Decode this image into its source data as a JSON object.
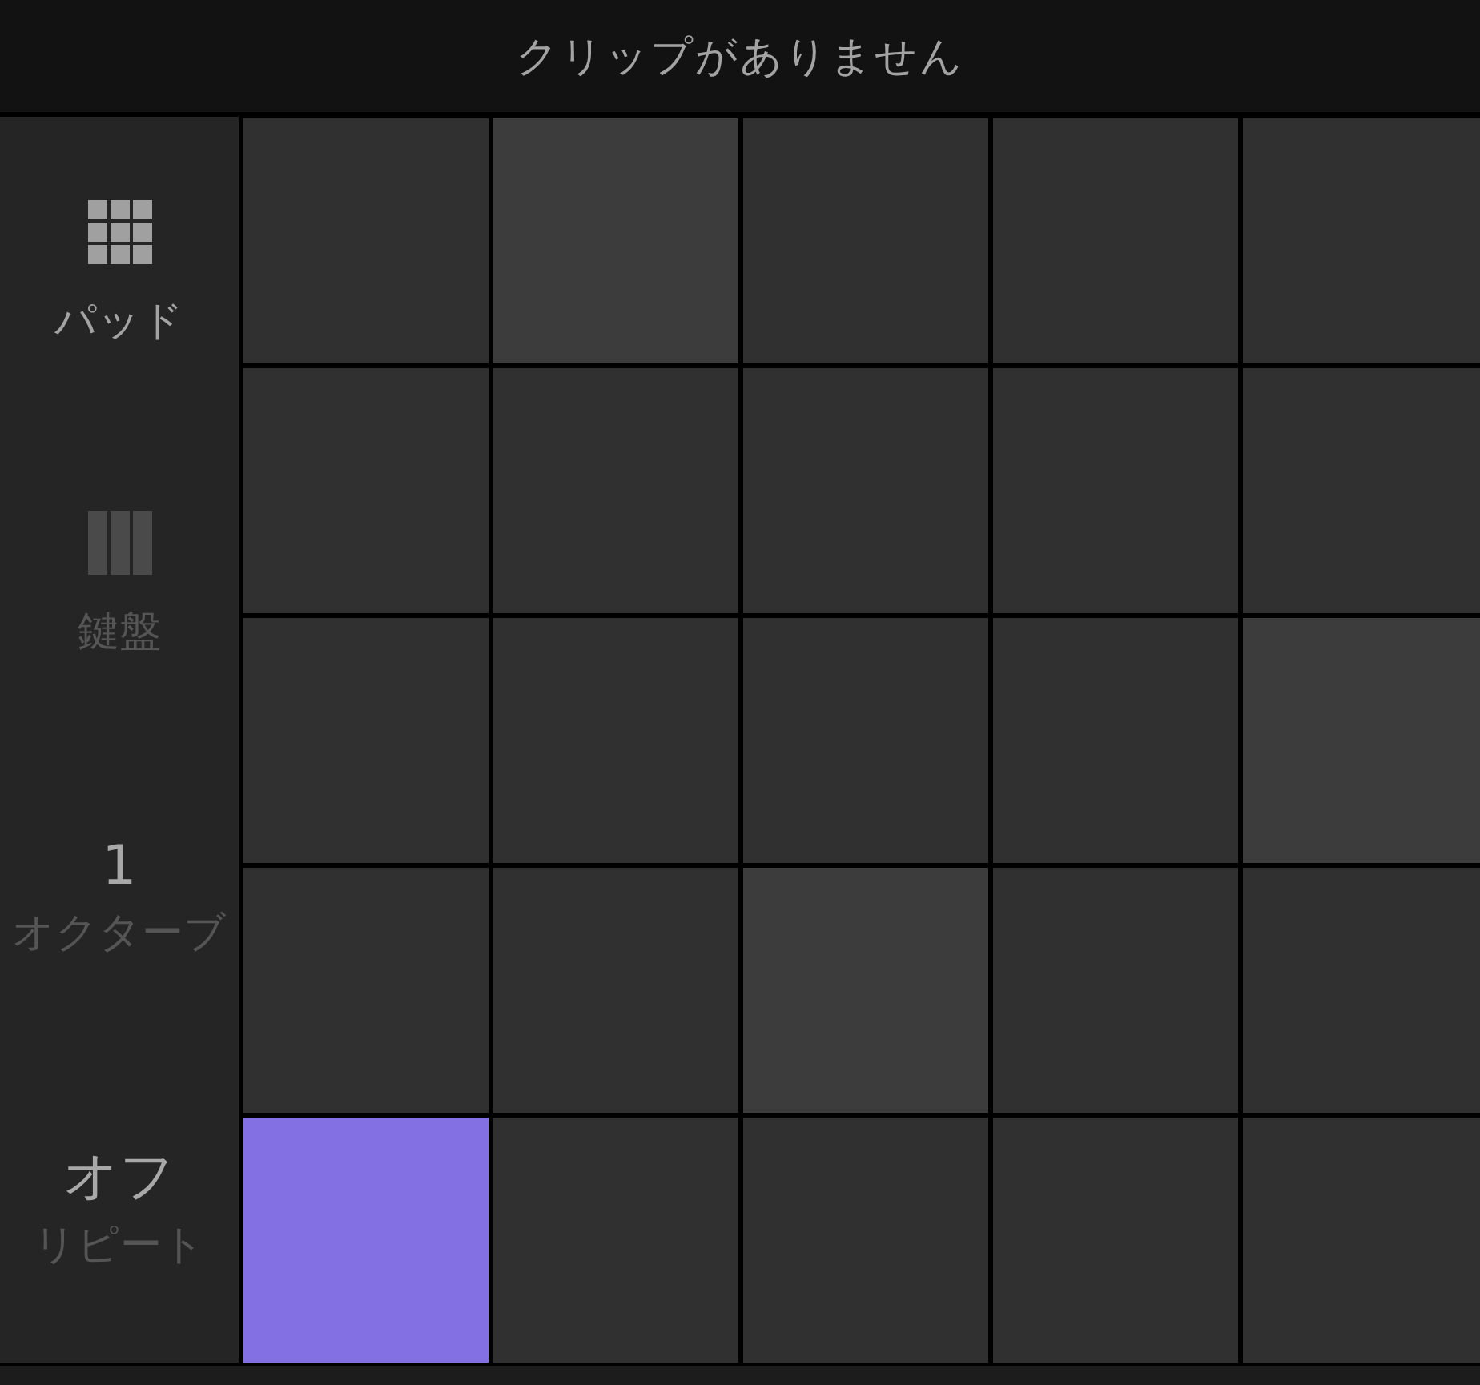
{
  "title": "クリップがありません",
  "sidebar": {
    "items": [
      {
        "kind": "pads",
        "label": "パッド",
        "selected": true
      },
      {
        "kind": "keys",
        "label": "鍵盤",
        "selected": false
      },
      {
        "kind": "value",
        "value": "1",
        "label": "オクターブ"
      },
      {
        "kind": "value",
        "value": "オフ",
        "label": "リピート"
      }
    ]
  },
  "pads": {
    "rows": [
      [
        {
          "color": "#303030"
        },
        {
          "color": "#3c3c3c"
        },
        {
          "color": "#303030"
        },
        {
          "color": "#303030"
        },
        {
          "color": "#303030"
        }
      ],
      [
        {
          "color": "#303030"
        },
        {
          "color": "#303030"
        },
        {
          "color": "#303030"
        },
        {
          "color": "#303030"
        },
        {
          "color": "#303030"
        }
      ],
      [
        {
          "color": "#303030"
        },
        {
          "color": "#303030"
        },
        {
          "color": "#303030"
        },
        {
          "color": "#303030"
        },
        {
          "color": "#3c3c3c"
        }
      ],
      [
        {
          "color": "#303030"
        },
        {
          "color": "#303030"
        },
        {
          "color": "#3c3c3c"
        },
        {
          "color": "#303030"
        },
        {
          "color": "#303030"
        }
      ],
      [
        {
          "color": "#8370e2"
        },
        {
          "color": "#303030"
        },
        {
          "color": "#303030"
        },
        {
          "color": "#303030"
        },
        {
          "color": "#303030"
        }
      ]
    ]
  }
}
